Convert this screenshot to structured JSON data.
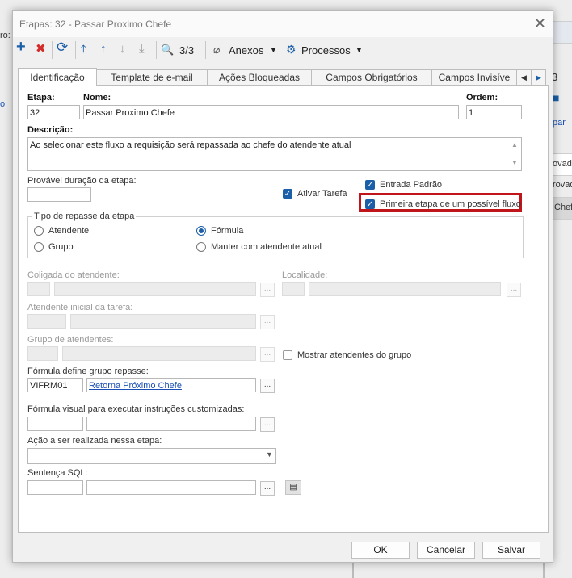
{
  "window": {
    "title": "Etapas: 32 - Passar Proximo Chefe",
    "close_glyph": "✕"
  },
  "background": {
    "label_ro": "ro:",
    "label_o": "o",
    "num_3": "3",
    "link_par": "par",
    "row1": "ovada",
    "row2": "rovad",
    "row3": "Chef"
  },
  "toolbar": {
    "add": "+",
    "delete": "✖",
    "refresh": "⟳",
    "first": "⤒",
    "prev": "↑",
    "next": "↓",
    "last": "⤓",
    "search": "🔍",
    "page": "3/3",
    "annexes": "Anexos",
    "processes": "Processos",
    "caret": "▼"
  },
  "tabs": [
    "Identificação",
    "Template de e-mail",
    "Ações Bloqueadas",
    "Campos Obrigatórios",
    "Campos Invisíve"
  ],
  "tab_scroll": {
    "left": "◀",
    "right": "▶"
  },
  "form": {
    "etapa_label": "Etapa:",
    "etapa_value": "32",
    "nome_label": "Nome:",
    "nome_value": "Passar Proximo Chefe",
    "ordem_label": "Ordem:",
    "ordem_value": "1",
    "descricao_label": "Descrição:",
    "descricao_value": "Ao selecionar este fluxo a requisição será repassada ao chefe do atendente atual",
    "duracao_label": "Provável duração da etapa:",
    "ativar_tarefa": "Ativar Tarefa",
    "entrada_padrao": "Entrada Padrão",
    "primeira_etapa": "Primeira etapa de um possível fluxo",
    "repasse_group": "Tipo de repasse da etapa",
    "repasse_options": [
      "Atendente",
      "Grupo",
      "Fórmula",
      "Manter com atendente atual"
    ],
    "repasse_selected": "Fórmula",
    "coligada_label": "Coligada do atendente:",
    "localidade_label": "Localidade:",
    "atendente_inicial_label": "Atendente inicial da tarefa:",
    "grupo_atendentes_label": "Grupo de atendentes:",
    "mostrar_atendentes": "Mostrar atendentes do grupo",
    "formula_grupo_label": "Fórmula define grupo repasse:",
    "formula_grupo_code": "VIFRM01",
    "formula_grupo_link": "Retorna Próximo Chefe",
    "formula_visual_label": "Fórmula visual para executar instruções customizadas:",
    "acao_label": "Ação a ser realizada nessa etapa:",
    "sentenca_label": "Sentença SQL:",
    "dots": "...",
    "check_glyph": "✓"
  },
  "buttons": {
    "ok": "OK",
    "cancel": "Cancelar",
    "save": "Salvar"
  },
  "colors": {
    "highlight_border": "#c0151a",
    "accent": "#1b5fa8",
    "link": "#1a4fb5"
  }
}
